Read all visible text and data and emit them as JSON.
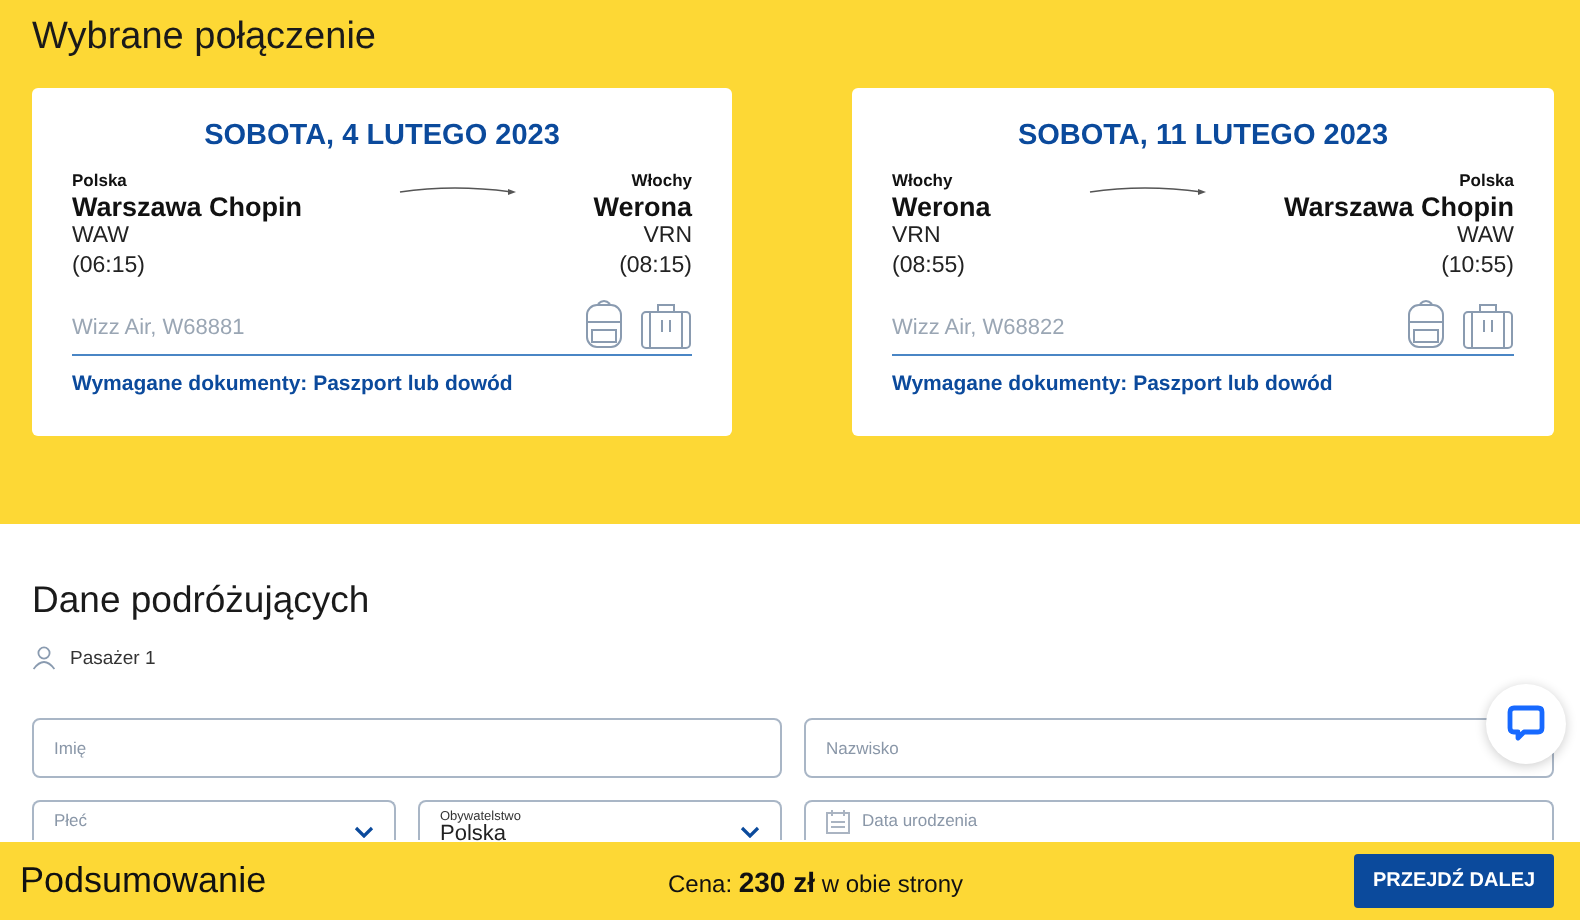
{
  "section_title": "Wybrane połączenie",
  "flights": [
    {
      "date": "SOBOTA, 4 LUTEGO 2023",
      "from": {
        "country": "Polska",
        "city": "Warszawa Chopin",
        "code": "WAW",
        "time": "(06:15)"
      },
      "to": {
        "country": "Włochy",
        "city": "Werona",
        "code": "VRN",
        "time": "(08:15)"
      },
      "carrier": "Wizz Air, W68881",
      "documents": "Wymagane dokumenty: Paszport lub dowód"
    },
    {
      "date": "SOBOTA, 11 LUTEGO 2023",
      "from": {
        "country": "Włochy",
        "city": "Werona",
        "code": "VRN",
        "time": "(08:55)"
      },
      "to": {
        "country": "Polska",
        "city": "Warszawa Chopin",
        "code": "WAW",
        "time": "(10:55)"
      },
      "carrier": "Wizz Air, W68822",
      "documents": "Wymagane dokumenty: Paszport lub dowód"
    }
  ],
  "travelers": {
    "title": "Dane podróżujących",
    "passenger": "Pasażer 1",
    "fields": [
      {
        "kind": "text",
        "placeholder": "Imię"
      },
      {
        "kind": "text",
        "placeholder": "Nazwisko"
      },
      {
        "kind": "select",
        "placeholder": "Płeć"
      },
      {
        "kind": "select",
        "label": "Obywatelstwo",
        "value": "Polska"
      },
      {
        "kind": "date",
        "placeholder": "Data urodzenia"
      }
    ]
  },
  "summary": {
    "title": "Podsumowanie",
    "price": "Cena: **230 zł** w obie strony",
    "button": "PRZEJDŹ DALEJ"
  }
}
